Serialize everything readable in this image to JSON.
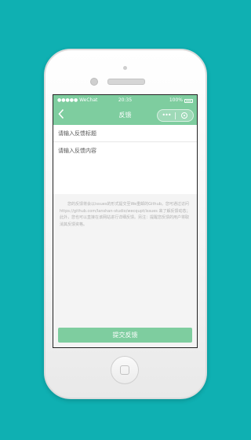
{
  "statusbar": {
    "carrier": "●●●●● WeChat",
    "time": "20:35",
    "battery": "100%"
  },
  "navbar": {
    "back_icon": "chevron-left-icon",
    "title": "反馈",
    "capsule_menu_icon": "more-dots-icon",
    "capsule_close_icon": "target-icon"
  },
  "form": {
    "title_placeholder": "请输入反馈标题",
    "content_placeholder": "请输入反馈内容",
    "notice": "您的反馈将会以issues的形式提交至We重邮的Github。您可通过访问 https://github.com/lanshan-studio/wecqupt/issues 来了解反馈动态；此外，您也可以直接在该网站进行详细反馈。另注：提醒您反馈的用户将取消其反馈资格。",
    "submit_label": "提交反馈"
  },
  "colors": {
    "accent": "#7ecd9f",
    "background": "#0fb0b2"
  }
}
